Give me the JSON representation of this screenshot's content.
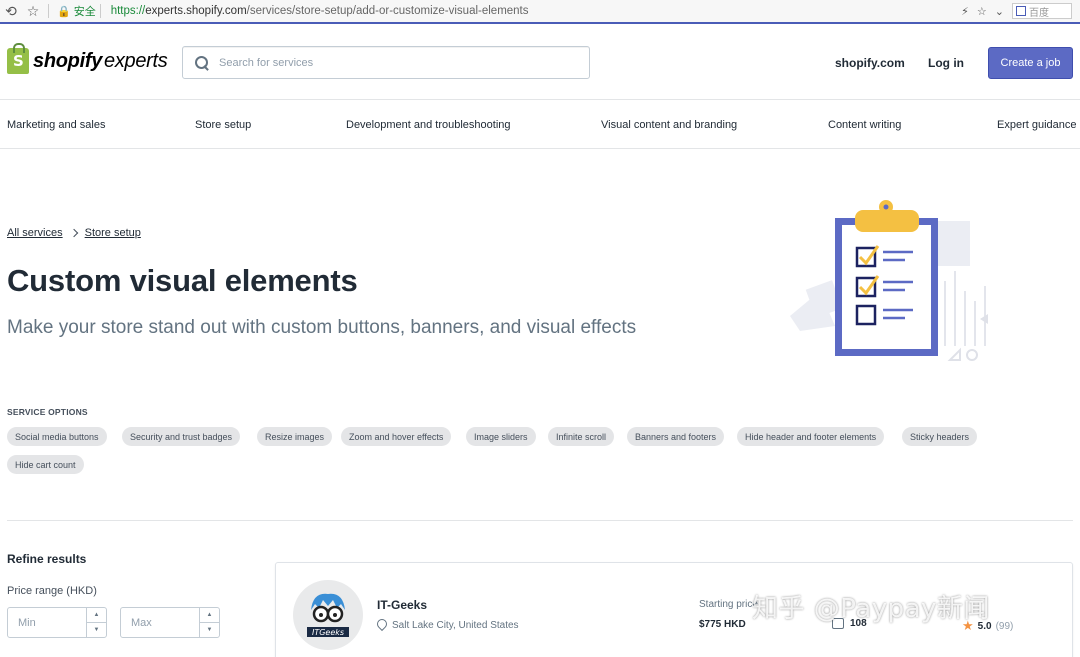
{
  "browser": {
    "secure_label": "安全",
    "url_protocol": "https://",
    "url_host": "experts.shopify.com",
    "url_path": "/services/store-setup/add-or-customize-visual-elements",
    "search_engine_label": "百度"
  },
  "header": {
    "logo_word1": "shopify",
    "logo_word2": "experts",
    "search_placeholder": "Search for services",
    "shop_link": "shopify.com",
    "login_link": "Log in",
    "create_job": "Create a job"
  },
  "categories": [
    "Marketing and sales",
    "Store setup",
    "Development and troubleshooting",
    "Visual content and branding",
    "Content writing",
    "Expert guidance"
  ],
  "hero": {
    "breadcrumb": [
      "All services",
      "Store setup"
    ],
    "title": "Custom visual elements",
    "subtitle": "Make your store stand out with custom buttons, banners, and visual effects"
  },
  "service_options": {
    "label": "SERVICE OPTIONS",
    "chips": [
      "Social media buttons",
      "Security and trust badges",
      "Resize images",
      "Zoom and hover effects",
      "Image sliders",
      "Infinite scroll",
      "Banners and footers",
      "Hide header and footer elements",
      "Sticky headers",
      "Hide cart count"
    ]
  },
  "refine": {
    "title": "Refine results",
    "price_label": "Price range (HKD)",
    "min_placeholder": "Min",
    "max_placeholder": "Max"
  },
  "expert": {
    "name": "IT-Geeks",
    "location": "Salt Lake City, United States",
    "avatar_text": "ITGeeks",
    "starting_label": "Starting price",
    "starting_price": "$775 HKD",
    "jobs": "108",
    "rating": "5.0",
    "reviews": "(99)"
  },
  "watermark": "知乎 @Paypay新闻",
  "colors": {
    "accent": "#5c6ac4",
    "shopify_green": "#95bf47",
    "chip_bg": "#e4e5e7",
    "star": "#f49342",
    "illus_purple": "#5c6ac4",
    "illus_yellow": "#f4c042"
  }
}
